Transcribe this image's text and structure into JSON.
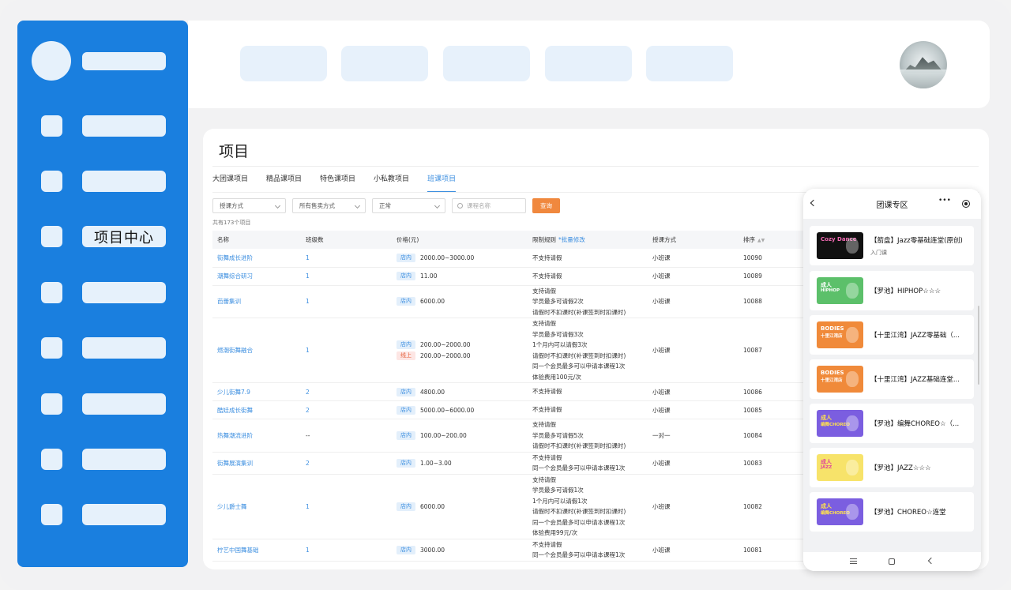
{
  "sidebar": {
    "active_label": "项目中心"
  },
  "main": {
    "title": "项目",
    "tabs": [
      {
        "label": "大团课项目"
      },
      {
        "label": "精品课项目"
      },
      {
        "label": "特色课项目"
      },
      {
        "label": "小私教项目"
      },
      {
        "label": "班课项目",
        "active": true
      }
    ],
    "filters": {
      "mode": "授课方式",
      "sale": "所有售卖方式",
      "status": "正常",
      "search_placeholder": "课程名称",
      "query_button": "查询"
    },
    "count_text": "共有173个项目",
    "columns": {
      "name": "名称",
      "classes": "班级数",
      "price": "价格(元)",
      "rule": "限制规则",
      "batch_edit": "*批量修改",
      "mode": "授课方式",
      "sort": "排序"
    },
    "rows": [
      {
        "name": "街舞成长进阶",
        "classes": "1",
        "prices": [
          {
            "tag": "店内",
            "value": "2000.00~3000.00"
          }
        ],
        "rules": [
          "不支持请假"
        ],
        "mode": "小班课",
        "sort": "10090"
      },
      {
        "name": "潮舞综合研习",
        "classes": "1",
        "prices": [
          {
            "tag": "店内",
            "value": "11.00"
          }
        ],
        "rules": [
          "不支持请假"
        ],
        "mode": "小班课",
        "sort": "10089"
      },
      {
        "name": "芭蕾集训",
        "classes": "1",
        "prices": [
          {
            "tag": "店内",
            "value": "6000.00"
          }
        ],
        "rules": [
          "支持请假",
          "学员最多可请假2次",
          "请假时不扣课时(补课签到时扣课时)"
        ],
        "mode": "小班课",
        "sort": "10088"
      },
      {
        "name": "燃潮街舞融合",
        "classes": "1",
        "prices": [
          {
            "tag": "店内",
            "value": "200.00~2000.00"
          },
          {
            "tag": "线上",
            "value": "200.00~2000.00"
          }
        ],
        "rules": [
          "支持请假",
          "学员最多可请假3次",
          "1个月内可以请假3次",
          "请假时不扣课时(补课签到时扣课时)",
          "同一个会员最多可以申请本课程1次",
          "体验费用100元/次"
        ],
        "mode": "小班课",
        "sort": "10087"
      },
      {
        "name": "少儿街舞7.9",
        "classes": "2",
        "prices": [
          {
            "tag": "店内",
            "value": "4800.00"
          }
        ],
        "rules": [
          "不支持请假"
        ],
        "mode": "小班课",
        "sort": "10086"
      },
      {
        "name": "酷娃成长街舞",
        "classes": "2",
        "prices": [
          {
            "tag": "店内",
            "value": "5000.00~6000.00"
          }
        ],
        "rules": [
          "不支持请假"
        ],
        "mode": "小班课",
        "sort": "10085"
      },
      {
        "name": "热舞潮流进阶",
        "classes": "--",
        "prices": [
          {
            "tag": "店内",
            "value": "100.00~200.00"
          }
        ],
        "rules": [
          "支持请假",
          "学员最多可请假5次",
          "请假时不扣课时(补课签到时扣课时)"
        ],
        "mode": "一对一",
        "sort": "10084"
      },
      {
        "name": "街舞展演集训",
        "classes": "2",
        "prices": [
          {
            "tag": "店内",
            "value": "1.00~3.00"
          }
        ],
        "rules": [
          "不支持请假",
          "同一个会员最多可以申请本课程1次"
        ],
        "mode": "小班课",
        "sort": "10083"
      },
      {
        "name": "少儿爵士舞",
        "classes": "1",
        "prices": [
          {
            "tag": "店内",
            "value": "6000.00"
          }
        ],
        "rules": [
          "支持请假",
          "学员最多可请假1次",
          "1个月内可以请假1次",
          "请假时不扣课时(补课签到时扣课时)",
          "同一个会员最多可以申请本课程1次",
          "体验费用99元/次"
        ],
        "mode": "小班课",
        "sort": "10082"
      },
      {
        "name": "柠艺中国舞基础",
        "classes": "1",
        "prices": [
          {
            "tag": "店内",
            "value": "3000.00"
          }
        ],
        "rules": [
          "不支持请假",
          "同一个会员最多可以申请本课程1次"
        ],
        "mode": "小班课",
        "sort": "10081"
      }
    ]
  },
  "phone": {
    "title": "团课专区",
    "dots_glyph": "•••",
    "items": [
      {
        "name": "【箭盘】Jazz零基础连堂(原创)",
        "sub": "入门课",
        "thumb_bg": "#111111",
        "thumb_title": "Cozy Dance",
        "thumb_sub": "",
        "title_color": "#f26ab3"
      },
      {
        "name": "【罗池】HIPHOP☆☆☆",
        "sub": "",
        "thumb_bg": "#5cc06a",
        "thumb_title": "成人",
        "thumb_sub": "HIPHOP",
        "title_color": "#ffffff"
      },
      {
        "name": "【十里江湾】JAZZ零基础（...",
        "sub": "",
        "thumb_bg": "#f08a3a",
        "thumb_title": "BODIES",
        "thumb_sub": "十里江湾店",
        "title_color": "#ffffff"
      },
      {
        "name": "【十里江湾】JAZZ基础连堂...",
        "sub": "",
        "thumb_bg": "#f08a3a",
        "thumb_title": "BODIES",
        "thumb_sub": "十里江湾店",
        "title_color": "#ffffff"
      },
      {
        "name": "【罗池】编舞CHOREO☆（...",
        "sub": "",
        "thumb_bg": "#7b5ee0",
        "thumb_title": "成人",
        "thumb_sub": "编舞CHOREO",
        "title_color": "#ffe14d"
      },
      {
        "name": "【罗池】JAZZ☆☆☆",
        "sub": "",
        "thumb_bg": "#f7e36a",
        "thumb_title": "成人",
        "thumb_sub": "JAZZ",
        "title_color": "#e0489a"
      },
      {
        "name": "【罗池】CHOREO☆连堂",
        "sub": "",
        "thumb_bg": "#7b5ee0",
        "thumb_title": "成人",
        "thumb_sub": "编舞CHOREO",
        "title_color": "#ffe14d"
      }
    ]
  }
}
